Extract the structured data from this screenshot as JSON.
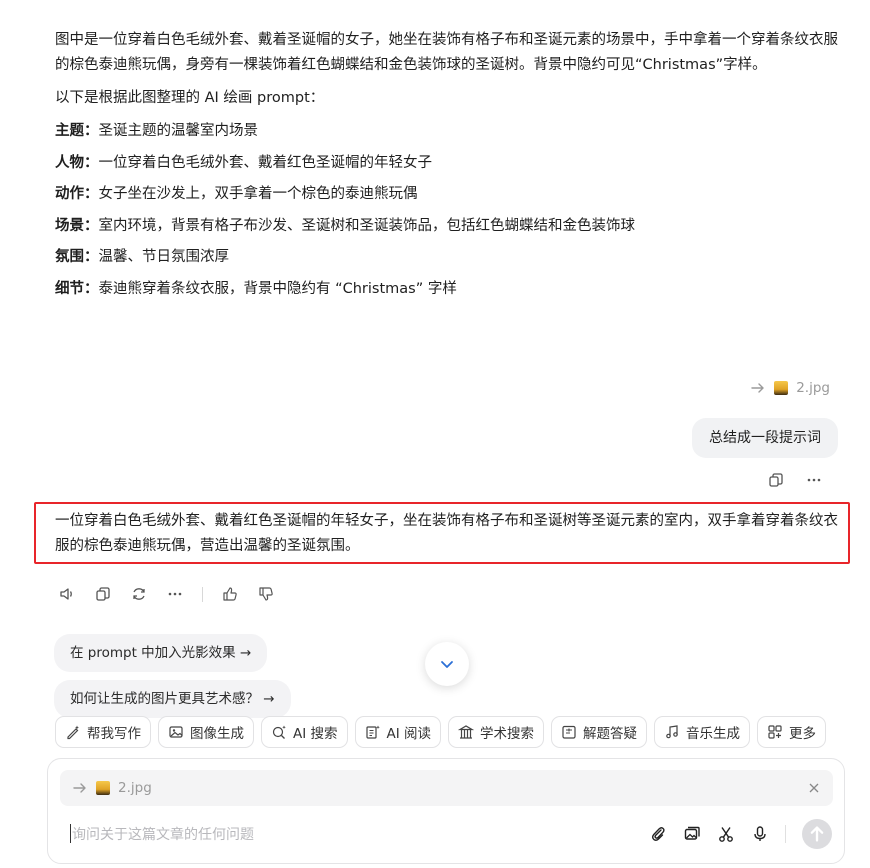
{
  "answer": {
    "intro": "图中是一位穿着白色毛绒外套、戴着圣诞帽的女子，她坐在装饰有格子布和圣诞元素的场景中，手中拿着一个穿着条纹衣服的棕色泰迪熊玩偶，身旁有一棵装饰着红色蝴蝶结和金色装饰球的圣诞树。背景中隐约可见“Christmas”字样。",
    "lead": "以下是根据此图整理的 AI 绘画 prompt：",
    "items": [
      {
        "key": "主题：",
        "value": "圣诞主题的温馨室内场景"
      },
      {
        "key": "人物：",
        "value": "一位穿着白色毛绒外套、戴着红色圣诞帽的年轻女子"
      },
      {
        "key": "动作：",
        "value": "女子坐在沙发上，双手拿着一个棕色的泰迪熊玩偶"
      },
      {
        "key": "场景：",
        "value": "室内环境，背景有格子布沙发、圣诞树和圣诞装饰品，包括红色蝴蝶结和金色装饰球"
      },
      {
        "key": "氛围：",
        "value": "温馨、节日氛围浓厚"
      },
      {
        "key": "细节：",
        "value": "泰迪熊穿着条纹衣服，背景中隐约有 “Christmas” 字样"
      }
    ]
  },
  "user_message": {
    "attachment_name": "2.jpg",
    "text": "总结成一段提示词"
  },
  "bot_reply": {
    "text": "一位穿着白色毛绒外套、戴着红色圣诞帽的年轻女子，坐在装饰有格子布和圣诞树等圣诞元素的室内，双手拿着穿着条纹衣服的棕色泰迪熊玩偶，营造出温馨的圣诞氛围。"
  },
  "suggestions": [
    "在 prompt 中加入光影效果 →",
    "如何让生成的图片更具艺术感？ →"
  ],
  "toolbar": [
    {
      "label": "帮我写作",
      "icon": "pen-sparkle-icon"
    },
    {
      "label": "图像生成",
      "icon": "image-icon"
    },
    {
      "label": "AI 搜索",
      "icon": "search-sparkle-icon"
    },
    {
      "label": "AI 阅读",
      "icon": "read-icon"
    },
    {
      "label": "学术搜索",
      "icon": "academic-icon"
    },
    {
      "label": "解题答疑",
      "icon": "solve-icon"
    },
    {
      "label": "音乐生成",
      "icon": "music-icon"
    },
    {
      "label": "更多",
      "icon": "grid-plus-icon"
    }
  ],
  "input": {
    "attachment_name": "2.jpg",
    "placeholder": "询问关于这篇文章的任何问题"
  },
  "colors": {
    "highlight_border": "#e8252a",
    "bubble_bg": "#f1f2f4"
  }
}
